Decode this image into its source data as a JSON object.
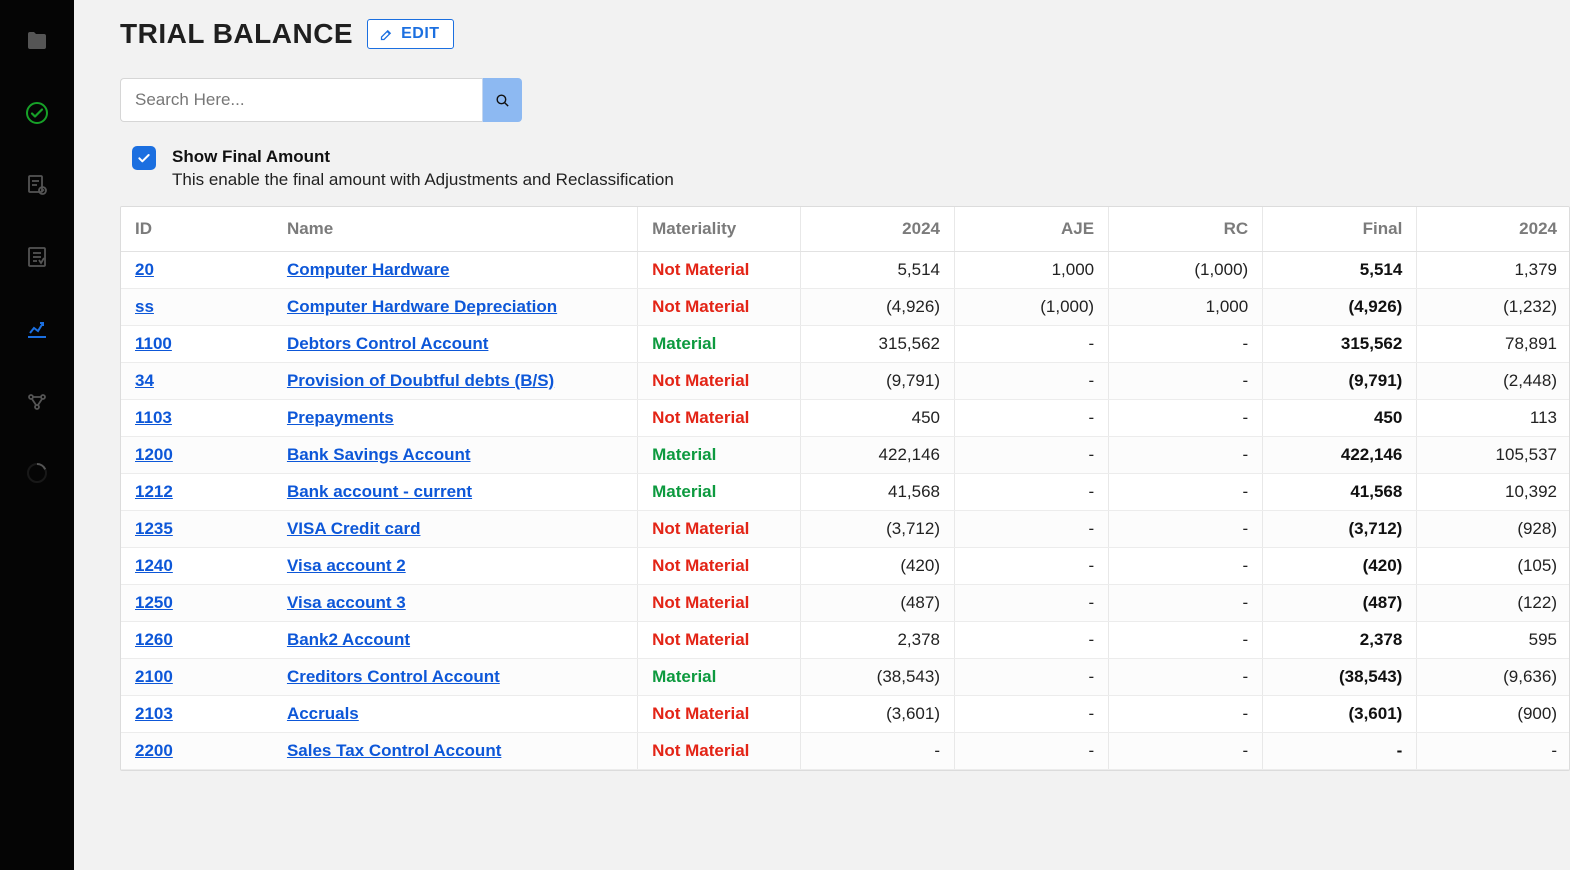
{
  "header": {
    "title": "TRIAL BALANCE",
    "edit": "EDIT"
  },
  "search": {
    "placeholder": "Search Here..."
  },
  "options": {
    "show_final": {
      "checked": true,
      "label": "Show Final Amount",
      "desc": "This enable the final amount with Adjustments and Reclassification"
    }
  },
  "materiality_labels": {
    "material": "Material",
    "not_material": "Not Material"
  },
  "table": {
    "columns": {
      "id": "ID",
      "name": "Name",
      "materiality": "Materiality",
      "year": "2024",
      "aje": "AJE",
      "rc": "RC",
      "final": "Final",
      "prev": "2024"
    },
    "rows": [
      {
        "id": "20",
        "name": "Computer Hardware",
        "materiality": "not_material",
        "year": "5,514",
        "aje": "1,000",
        "rc": "(1,000)",
        "final": "5,514",
        "prev": "1,379"
      },
      {
        "id": "ss",
        "name": "Computer Hardware Depreciation",
        "materiality": "not_material",
        "year": "(4,926)",
        "aje": "(1,000)",
        "rc": "1,000",
        "final": "(4,926)",
        "prev": "(1,232)"
      },
      {
        "id": "1100",
        "name": "Debtors Control Account",
        "materiality": "material",
        "year": "315,562",
        "aje": "-",
        "rc": "-",
        "final": "315,562",
        "prev": "78,891"
      },
      {
        "id": "34",
        "name": "Provision of Doubtful debts (B/S)",
        "materiality": "not_material",
        "year": "(9,791)",
        "aje": "-",
        "rc": "-",
        "final": "(9,791)",
        "prev": "(2,448)"
      },
      {
        "id": "1103",
        "name": "Prepayments",
        "materiality": "not_material",
        "year": "450",
        "aje": "-",
        "rc": "-",
        "final": "450",
        "prev": "113"
      },
      {
        "id": "1200",
        "name": "Bank Savings Account",
        "materiality": "material",
        "year": "422,146",
        "aje": "-",
        "rc": "-",
        "final": "422,146",
        "prev": "105,537"
      },
      {
        "id": "1212",
        "name": "Bank account - current",
        "materiality": "material",
        "year": "41,568",
        "aje": "-",
        "rc": "-",
        "final": "41,568",
        "prev": "10,392"
      },
      {
        "id": "1235",
        "name": "VISA Credit card",
        "materiality": "not_material",
        "year": "(3,712)",
        "aje": "-",
        "rc": "-",
        "final": "(3,712)",
        "prev": "(928)"
      },
      {
        "id": "1240",
        "name": "Visa account 2",
        "materiality": "not_material",
        "year": "(420)",
        "aje": "-",
        "rc": "-",
        "final": "(420)",
        "prev": "(105)"
      },
      {
        "id": "1250",
        "name": "Visa account 3",
        "materiality": "not_material",
        "year": "(487)",
        "aje": "-",
        "rc": "-",
        "final": "(487)",
        "prev": "(122)"
      },
      {
        "id": "1260",
        "name": "Bank2 Account",
        "materiality": "not_material",
        "year": "2,378",
        "aje": "-",
        "rc": "-",
        "final": "2,378",
        "prev": "595"
      },
      {
        "id": "2100",
        "name": "Creditors Control Account",
        "materiality": "material",
        "year": "(38,543)",
        "aje": "-",
        "rc": "-",
        "final": "(38,543)",
        "prev": "(9,636)"
      },
      {
        "id": "2103",
        "name": "Accruals",
        "materiality": "not_material",
        "year": "(3,601)",
        "aje": "-",
        "rc": "-",
        "final": "(3,601)",
        "prev": "(900)"
      },
      {
        "id": "2200",
        "name": "Sales Tax Control Account",
        "materiality": "not_material",
        "year": "-",
        "aje": "-",
        "rc": "-",
        "final": "-",
        "prev": "-"
      }
    ]
  }
}
